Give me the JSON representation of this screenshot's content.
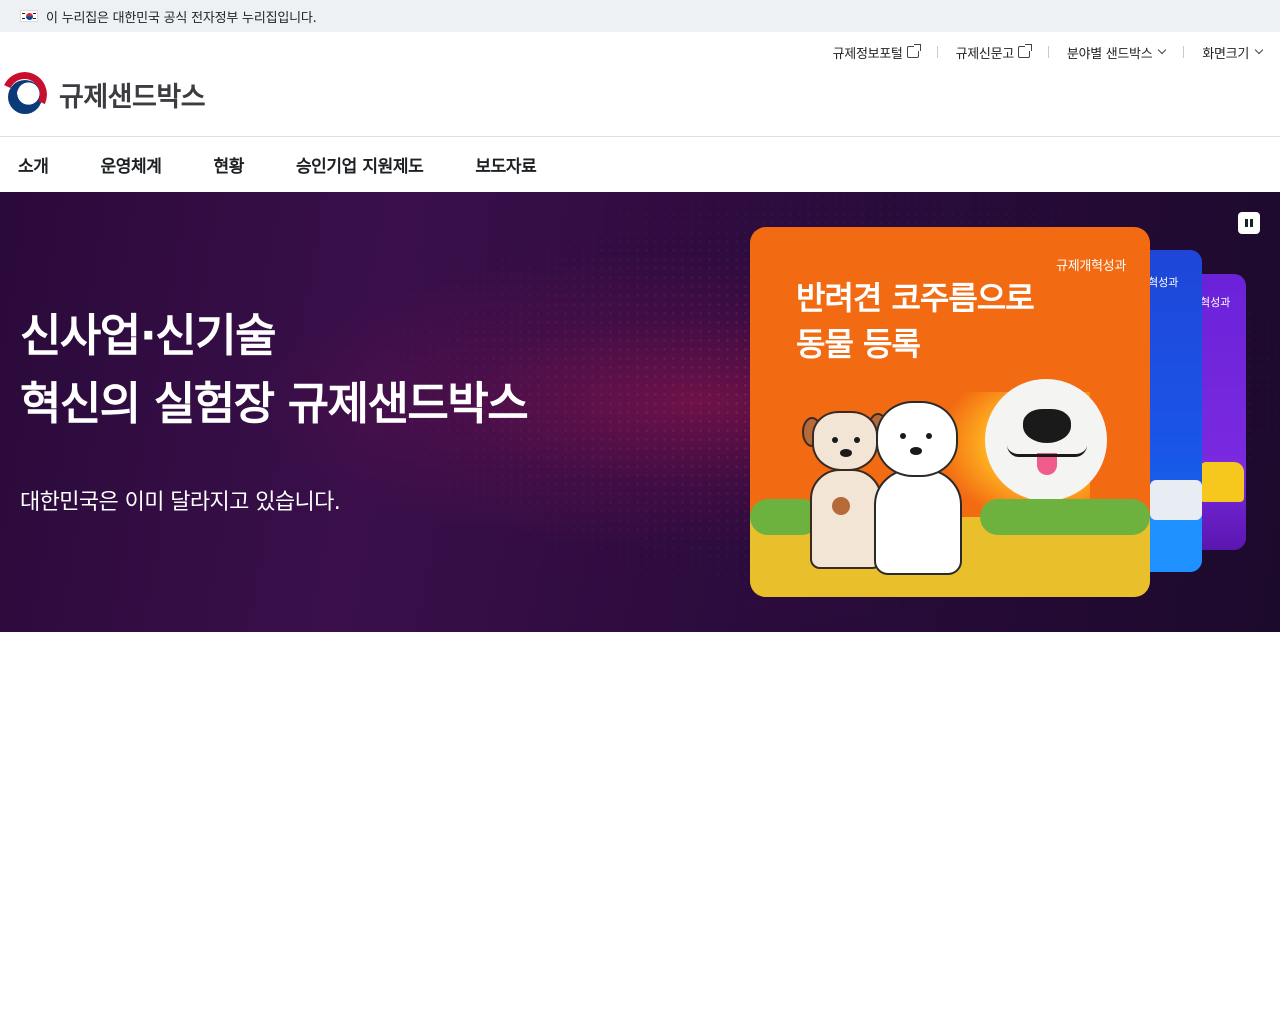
{
  "gov_banner": {
    "flag_icon": "korean-flag-icon",
    "text": "이 누리집은 대한민국 공식 전자정부 누리집입니다."
  },
  "utility_nav": {
    "items": [
      {
        "label": "규제정보포털",
        "icon": "external-link-icon"
      },
      {
        "label": "규제신문고",
        "icon": "external-link-icon"
      },
      {
        "label": "분야별 샌드박스",
        "icon": "chevron-down-icon"
      },
      {
        "label": "화면크기",
        "icon": "chevron-down-icon"
      }
    ]
  },
  "logo": {
    "text": "규제샌드박스",
    "icon": "government-emblem-icon"
  },
  "main_nav": {
    "items": [
      "소개",
      "운영체계",
      "현황",
      "승인기업 지원제도",
      "보도자료"
    ]
  },
  "hero": {
    "title_line1": "신사업·신기술",
    "title_line2": "혁신의 실험장 규제샌드박스",
    "subtitle": "대한민국은 이미 달라지고 있습니다.",
    "pause_icon": "pause-icon",
    "cards": [
      {
        "label": "규제개혁성과",
        "title_line1": "반려견 코주름으로",
        "title_line2": "동물 등록"
      },
      {
        "label": "혁성과"
      },
      {
        "label": "혁성과"
      }
    ]
  },
  "colors": {
    "hero_bg": "#2a0a3a",
    "card_front": "#f26a12",
    "card_back1": "#1f46d8",
    "card_back2": "#6a22d8",
    "banner_bg": "#eef1f4"
  }
}
